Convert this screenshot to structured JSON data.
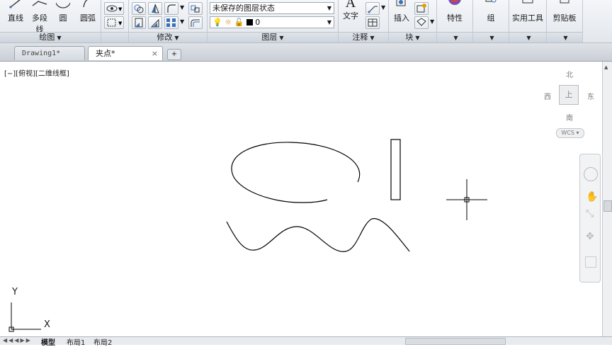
{
  "ribbon": {
    "draw_panel": {
      "title": "绘图",
      "line_label": "直线",
      "polyline_label": "多段线",
      "circle_label": "圆",
      "arc_label": "圆弧"
    },
    "modify_panel": {
      "title": "修改"
    },
    "layer_panel": {
      "title": "图层",
      "layer_state_value": "未保存的图层状态",
      "layer_value": "0"
    },
    "annotation_panel": {
      "title": "注释",
      "text_label": "文字"
    },
    "block_panel": {
      "title": "块",
      "insert_label": "插入"
    },
    "properties_label": "特性",
    "group_label": "组",
    "utilities_label": "实用工具",
    "clipboard_label": "剪贴板"
  },
  "tabs": [
    {
      "label": "Drawing1*"
    },
    {
      "label": "夹点*"
    }
  ],
  "viewport": {
    "view_label": "[−][俯视][二维线框]",
    "compass": {
      "north": "北",
      "south": "南",
      "east": "东",
      "west": "西",
      "center": "上"
    },
    "wcs_label": "WCS",
    "ucs": {
      "x": "X",
      "y": "Y"
    }
  },
  "layout_tabs": [
    "模型",
    "布局1",
    "布局2"
  ],
  "colors": {
    "accent": "#3b6fb6",
    "layer_swatch": "#000000"
  }
}
